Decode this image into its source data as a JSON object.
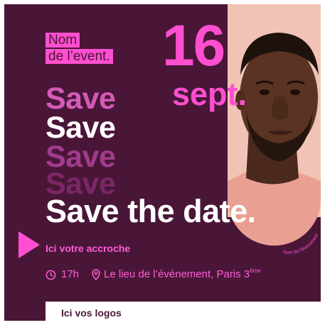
{
  "event": {
    "name_line1": "Nom",
    "name_line2": "de l’event."
  },
  "date": {
    "day": "16",
    "month": "sept."
  },
  "save_words": [
    "Save",
    "Save",
    "Save",
    "Save"
  ],
  "headline": "Save the date.",
  "tagline": "Ici votre accroche",
  "details": {
    "time": "17h",
    "location": "Le lieu de l’événement, Paris 3",
    "location_sup": "ème"
  },
  "circular_text": "Nom de l’événement",
  "footer": {
    "logos_label": "Ici vos logos"
  },
  "colors": {
    "background": "#4a1638",
    "accent": "#ff4fd0",
    "skin_backdrop": "#f1c3b6",
    "white": "#ffffff"
  },
  "icons": [
    "play-triangle-icon",
    "clock-icon",
    "location-pin-icon"
  ]
}
